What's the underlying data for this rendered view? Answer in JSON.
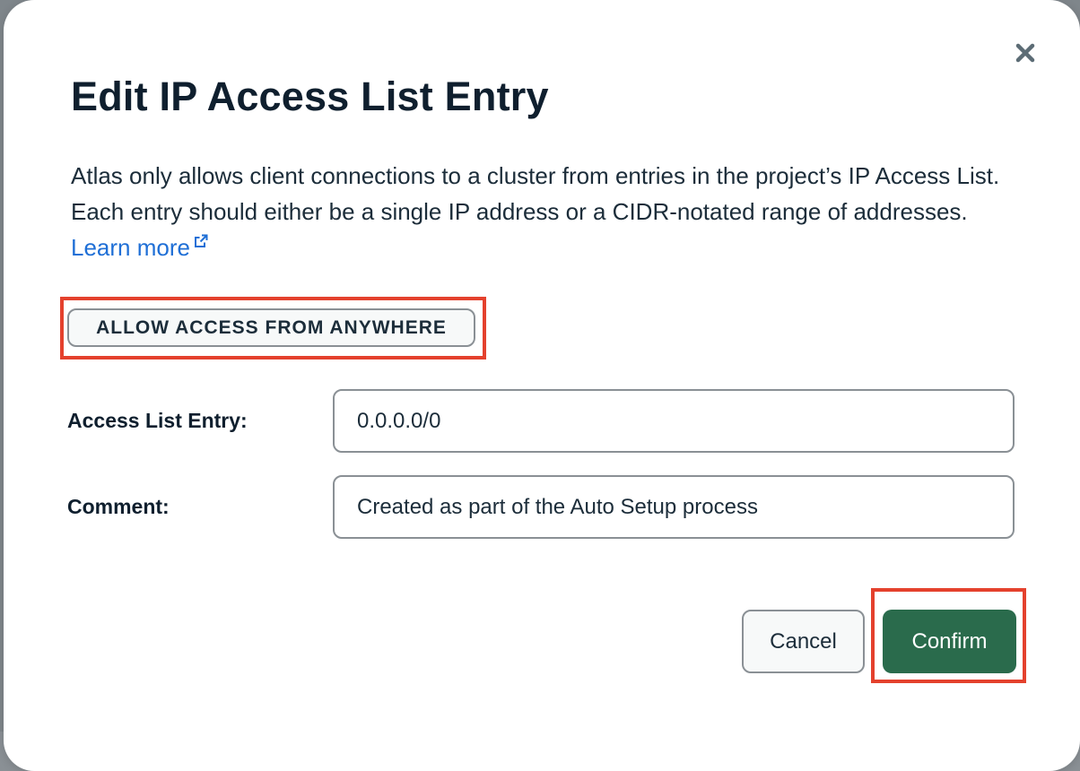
{
  "dialog": {
    "title": "Edit IP Access List Entry",
    "description": "Atlas only allows client connections to a cluster from entries in the project’s IP Access List. Each entry should either be a single IP address or a CIDR-notated range of addresses.",
    "learn_more_label": "Learn more",
    "allow_anywhere_label": "ALLOW ACCESS FROM ANYWHERE",
    "close_icon": "close-icon",
    "external_link_icon": "external-link-icon"
  },
  "form": {
    "access_list_entry": {
      "label": "Access List Entry:",
      "value": "0.0.0.0/0"
    },
    "comment": {
      "label": "Comment:",
      "value": "Created as part of the Auto Setup process"
    }
  },
  "footer": {
    "cancel_label": "Cancel",
    "confirm_label": "Confirm"
  },
  "colors": {
    "primary_button": "#2a6b4c",
    "link": "#1f6fd6",
    "highlight_outline": "#e4412d",
    "text": "#1c2d3a"
  }
}
